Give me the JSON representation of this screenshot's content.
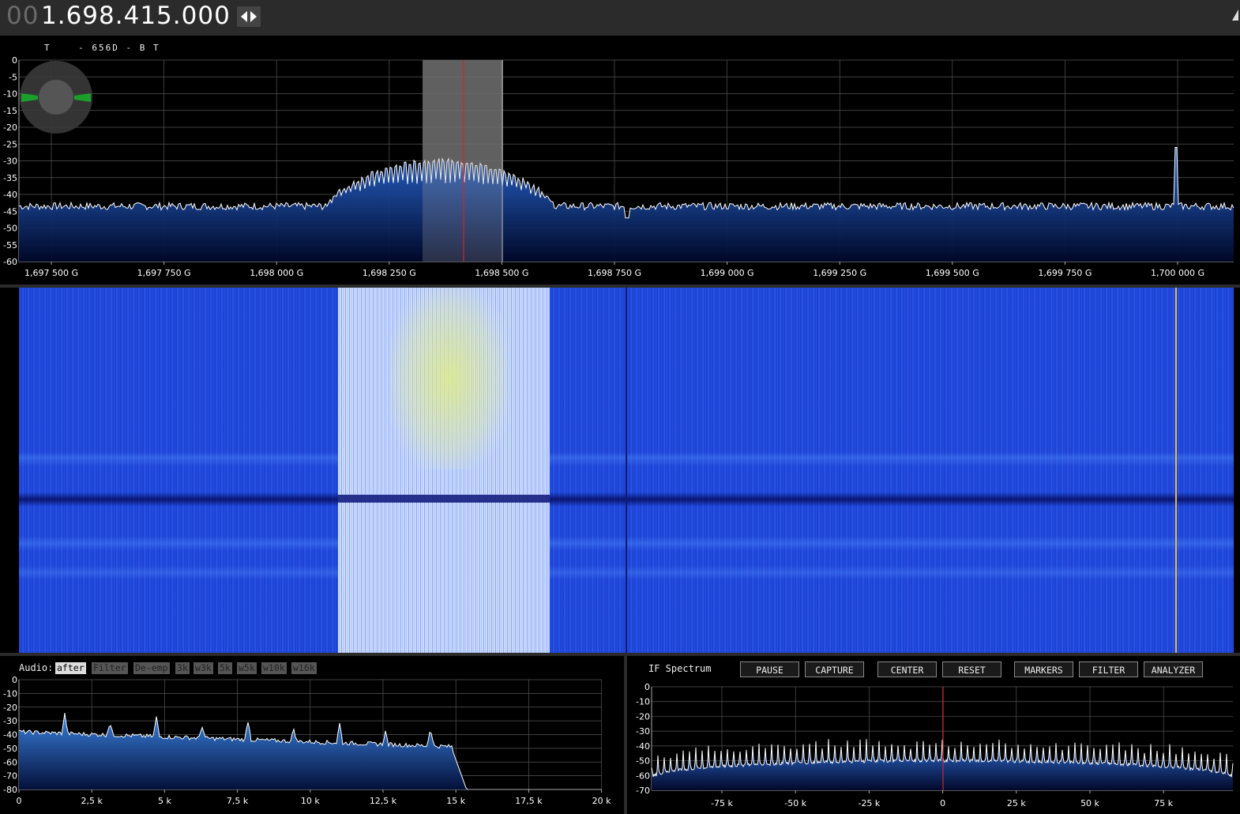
{
  "topbar": {
    "freq_lead": "00",
    "freq_main": "1.698.415.000"
  },
  "mode_text": "T    - 656D - B T",
  "main_spectrum": {
    "y_ticks": [
      "0",
      "-5",
      "-10",
      "-15",
      "-20",
      "-25",
      "-30",
      "-35",
      "-40",
      "-45",
      "-50",
      "-55",
      "-60"
    ],
    "x_ticks": [
      "1,697 500 G",
      "1,697 750 G",
      "1,698 000 G",
      "1,698 250 G",
      "1,698 500 G",
      "1,698 750 G",
      "1,699 000 G",
      "1,699 250 G",
      "1,699 500 G",
      "1,699 750 G",
      "1,700 000 G"
    ],
    "ylim": [
      -60,
      0
    ],
    "colors": {
      "tune_marker": "#e02020",
      "filter_band": "#5a5a5a",
      "trace": "#ffffff"
    }
  },
  "audio": {
    "label": "Audio:",
    "modes": [
      {
        "label": "after",
        "active": true
      },
      {
        "label": "Filter",
        "active": false
      },
      {
        "label": "De-emp",
        "active": false
      },
      {
        "label": "3k",
        "active": false
      },
      {
        "label": "w3k",
        "active": false
      },
      {
        "label": "5k",
        "active": false
      },
      {
        "label": "w5k",
        "active": false
      },
      {
        "label": "w10k",
        "active": false
      },
      {
        "label": "w16k",
        "active": false
      }
    ],
    "y_ticks": [
      "0",
      "-10",
      "-20",
      "-30",
      "-40",
      "-50",
      "-60",
      "-70",
      "-80"
    ],
    "x_ticks": [
      "0",
      "2,5 k",
      "5 k",
      "7,5 k",
      "10 k",
      "12,5 k",
      "15 k",
      "17,5 k",
      "20 k"
    ],
    "ylim": [
      -80,
      0
    ]
  },
  "if_spectrum": {
    "title": "IF Spectrum",
    "buttons": [
      "PAUSE",
      "CAPTURE",
      "CENTER",
      "RESET",
      "MARKERS",
      "FILTER",
      "ANALYZER"
    ],
    "y_ticks": [
      "0",
      "-10",
      "-20",
      "-30",
      "-40",
      "-50",
      "-60",
      "-70"
    ],
    "x_ticks": [
      "-75 k",
      "-50 k",
      "-25 k",
      "0",
      "25 k",
      "50 k",
      "75 k"
    ],
    "ylim": [
      -70,
      0
    ]
  }
}
